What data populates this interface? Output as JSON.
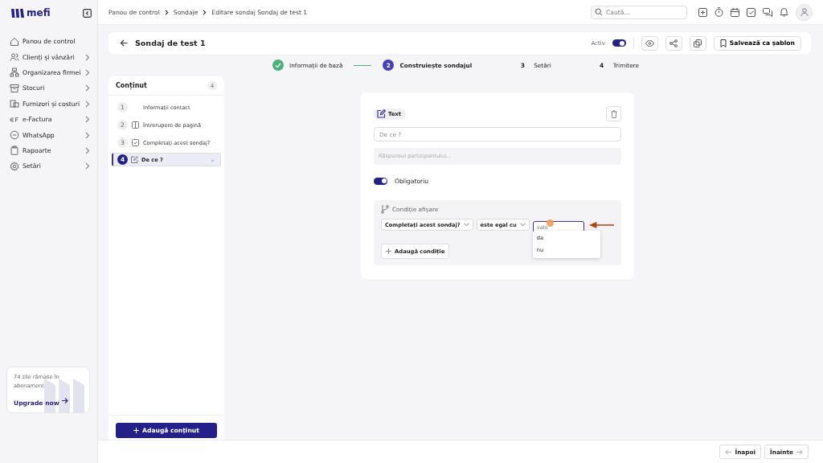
{
  "sidebar": {
    "logo": "mefi",
    "items": [
      {
        "label": "Panou de control",
        "expandable": false
      },
      {
        "label": "Clienți și vânzări",
        "expandable": true
      },
      {
        "label": "Organizarea firmei",
        "expandable": true
      },
      {
        "label": "Stocuri",
        "expandable": true
      },
      {
        "label": "Furnizori și costuri",
        "expandable": true
      },
      {
        "label": "e-Factura",
        "expandable": true
      },
      {
        "label": "WhatsApp",
        "expandable": true
      },
      {
        "label": "Rapoarte",
        "expandable": true
      },
      {
        "label": "Setări",
        "expandable": true
      }
    ],
    "promo": {
      "text": "74 zile rămase în abonament",
      "link": "Upgrade now"
    }
  },
  "breadcrumbs": [
    "Panou de control",
    "Sondaje",
    "Editare sondaj Sondaj de test 1"
  ],
  "search": {
    "placeholder": "Caută..."
  },
  "header": {
    "title": "Sondaj de test 1",
    "active_label": "Activ",
    "active": true,
    "save_template": "Salvează ca șablon"
  },
  "steps": [
    {
      "label": "Informații de bază",
      "completed": true,
      "selected": false
    },
    {
      "number": "2",
      "label": "Construiește sondajul",
      "completed": false,
      "selected": true
    },
    {
      "number": "3",
      "label": "Setări",
      "completed": false,
      "selected": false
    },
    {
      "number": "4",
      "label": "Trimitere",
      "completed": false,
      "selected": false
    }
  ],
  "content_panel": {
    "title": "Conținut",
    "count": "4",
    "add_button": "Adaugă conținut",
    "items": [
      {
        "number": "1",
        "label": "Informații contact",
        "kind": "contact",
        "selected": false
      },
      {
        "number": "2",
        "label": "Întrerupere de pagină",
        "kind": "page_break",
        "selected": false
      },
      {
        "number": "3",
        "label": "Completați acest sondaj?",
        "kind": "choice",
        "selected": false
      },
      {
        "number": "4",
        "label": "De ce ?",
        "kind": "text",
        "selected": true
      }
    ]
  },
  "editor": {
    "type_label": "Text",
    "question": "De ce ?",
    "answer_placeholder": "Răspunsul participantului...",
    "required_label": "Obligatoriu",
    "required": true,
    "condition": {
      "title": "Condiție afișare",
      "field": "Completați acest sondaj?",
      "operator": "este egal cu",
      "value_placeholder": "valo",
      "options": [
        "da",
        "nu"
      ],
      "add_button": "Adaugă condiție"
    }
  },
  "footer": {
    "back": "Înapoi",
    "next": "Înainte"
  }
}
